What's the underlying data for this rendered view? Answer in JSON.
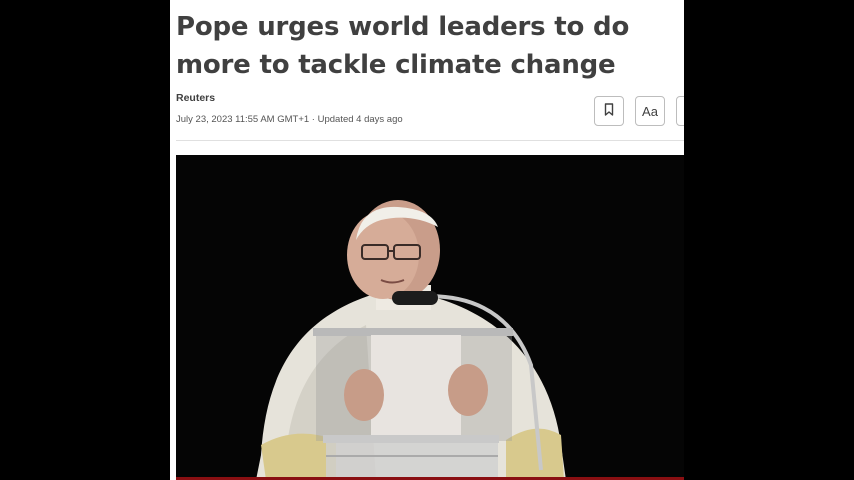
{
  "article": {
    "headline": "Pope urges world leaders to do more to tackle climate change",
    "source": "Reuters",
    "dateline": "July 23, 2023 11:55 AM GMT+1 · Updated 4 days ago"
  },
  "toolbar": {
    "bookmark_icon": "bookmark-icon",
    "text_size_label": "Aa",
    "share_icon": "share-icon"
  },
  "photo": {
    "subject": "pope-at-lectern"
  }
}
